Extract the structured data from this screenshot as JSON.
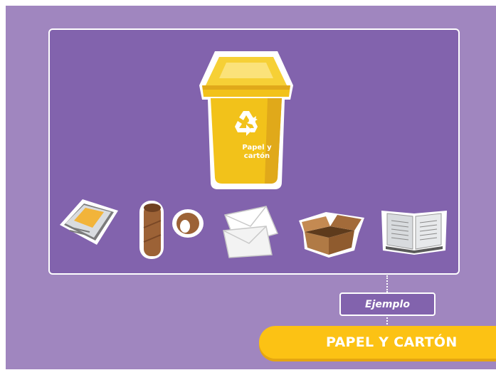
{
  "bin": {
    "label_line1": "Papel y",
    "label_line2": "cartón"
  },
  "example_label": "Ejemplo",
  "category_title": "PAPEL Y CARTÓN",
  "items": [
    {
      "name": "newspaper-icon"
    },
    {
      "name": "cardboard-tubes-icon"
    },
    {
      "name": "envelopes-icon"
    },
    {
      "name": "cardboard-box-icon"
    },
    {
      "name": "open-book-icon"
    }
  ],
  "colors": {
    "background": "#a086bf",
    "panel": "#8263ad",
    "bin": "#f2c21a",
    "banner": "#fcc214"
  }
}
